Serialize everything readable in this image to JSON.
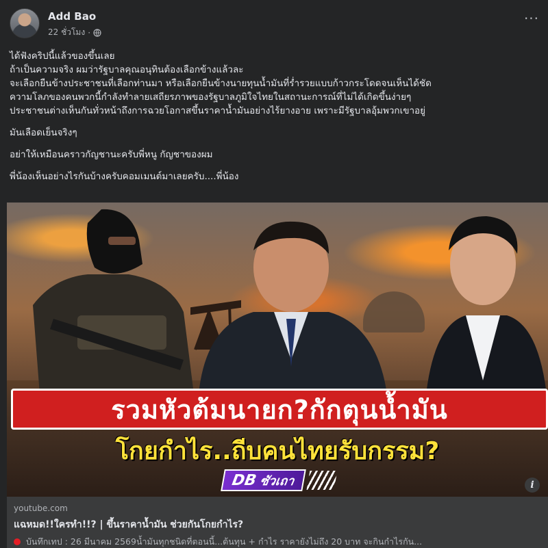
{
  "post": {
    "author": "Add Bao",
    "time": "22 ชั่วโมง",
    "separator": "·",
    "paragraphs": [
      "ได้ฟังคริปนี้แล้วของขึ้นเลย",
      "ถ้าเป็นความจริง ผมว่ารัฐบาลคุณอนุทินต้องเลือกข้างแล้วละ",
      "จะเลือกยืนข้างประชาชนที่เลือกท่านมา หรือเลือกยืนข้างนายทุนน้ำมันที่ร่ำรวยแบบก้าวกระโดดจนเห็นได้ชัด",
      "ความโลภของคนพวกนี้กำลังทำลายเสถียรภาพของรัฐบาลภูมิใจไทยในสถานะการณ์ที่ไม่ได้เกิดขึ้นง่ายๆ",
      "ประชาชนต่างเห็นกันทั่วหน้าถึงการฉวยโอกาสขึ้นราคาน้ำมันอย่างไร้ยางอาย เพราะมีรัฐบาลอุ้มพวกเขาอยู่"
    ],
    "paragraph_2": "มันเลือดเย็นจริงๆ",
    "paragraph_3": "อย่าให้เหมือนคราวกัญชานะครับพี่หนู กัญชาของผม",
    "paragraph_4": "พี่น้องเห็นอย่างไรกันบ้างครับคอมเมนต์มาเลยครับ....พี่น้อง"
  },
  "media": {
    "headline_line1": "รวมหัวต้มนายก?กักตุนน้ำมัน",
    "headline_line2": "โกยกำไร..ถีบคนไทยรับกรรม?",
    "brand_db": "DB",
    "brand_name": "ซัวเถา"
  },
  "link": {
    "domain": "youtube.com",
    "title": "แฉหมด!!ใครทำ!!? | ขึ้นราคาน้ำมัน ช่วยกันโกยกำไร?",
    "description": "บันทึกเทป : 26 มีนาคม 2569น้ำมันทุกชนิดที่ตอนนี้...ต้นทุน + กำไร ราคายังไม่ถึง 20 บาท จะกินกำไรกัน..."
  },
  "icons": {
    "more": "more-options-icon",
    "globe": "globe-icon",
    "info": "info-icon",
    "red_dot": "red-dot-icon"
  },
  "colors": {
    "background": "#242526",
    "headline_red": "#d01f1f",
    "headline_yellow": "#ffe23a",
    "brand_purple": "#7a2fd0"
  }
}
